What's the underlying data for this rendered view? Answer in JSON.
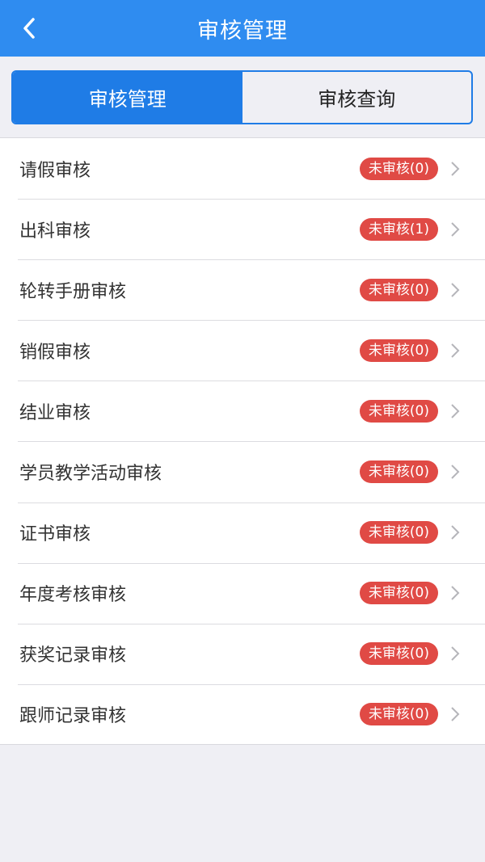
{
  "header": {
    "back_icon": "chevron-left-icon",
    "title": "审核管理"
  },
  "tabs": [
    {
      "label": "审核管理",
      "active": true
    },
    {
      "label": "审核查询",
      "active": false
    }
  ],
  "items": [
    {
      "label": "请假审核",
      "badge": "未审核(0)"
    },
    {
      "label": "出科审核",
      "badge": "未审核(1)"
    },
    {
      "label": "轮转手册审核",
      "badge": "未审核(0)"
    },
    {
      "label": "销假审核",
      "badge": "未审核(0)"
    },
    {
      "label": "结业审核",
      "badge": "未审核(0)"
    },
    {
      "label": "学员教学活动审核",
      "badge": "未审核(0)"
    },
    {
      "label": "证书审核",
      "badge": "未审核(0)"
    },
    {
      "label": "年度考核审核",
      "badge": "未审核(0)"
    },
    {
      "label": "获奖记录审核",
      "badge": "未审核(0)"
    },
    {
      "label": "跟师记录审核",
      "badge": "未审核(0)"
    }
  ],
  "colors": {
    "nav_bg": "#2f8cf0",
    "tab_active": "#1f7ce6",
    "badge_bg": "#e04a45",
    "page_bg": "#efeff4"
  }
}
